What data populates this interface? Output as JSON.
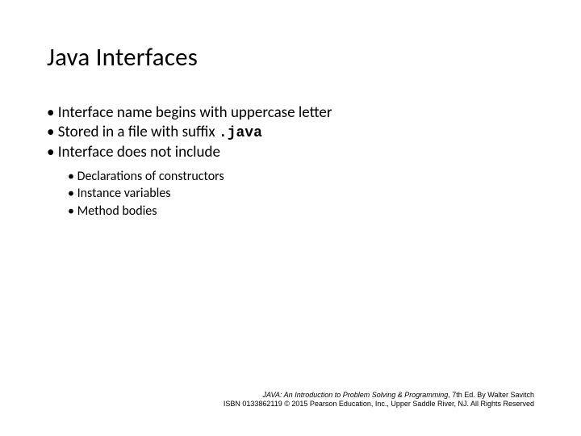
{
  "slide": {
    "title": "Java Interfaces",
    "bullets": [
      {
        "text": "Interface name begins with uppercase letter"
      },
      {
        "prefix": "Stored in a file with suffix ",
        "code": ".java"
      },
      {
        "text": "Interface does not include",
        "sub": [
          "Declarations of constructors",
          "Instance variables",
          "Method bodies"
        ]
      }
    ],
    "footer": {
      "line1_book": "JAVA: An Introduction to Problem Solving & Programming",
      "line1_rest": ", 7th Ed. By Walter Savitch",
      "line2": "ISBN 0133862119 © 2015 Pearson Education, Inc., Upper Saddle River, NJ. All Rights Reserved"
    }
  }
}
